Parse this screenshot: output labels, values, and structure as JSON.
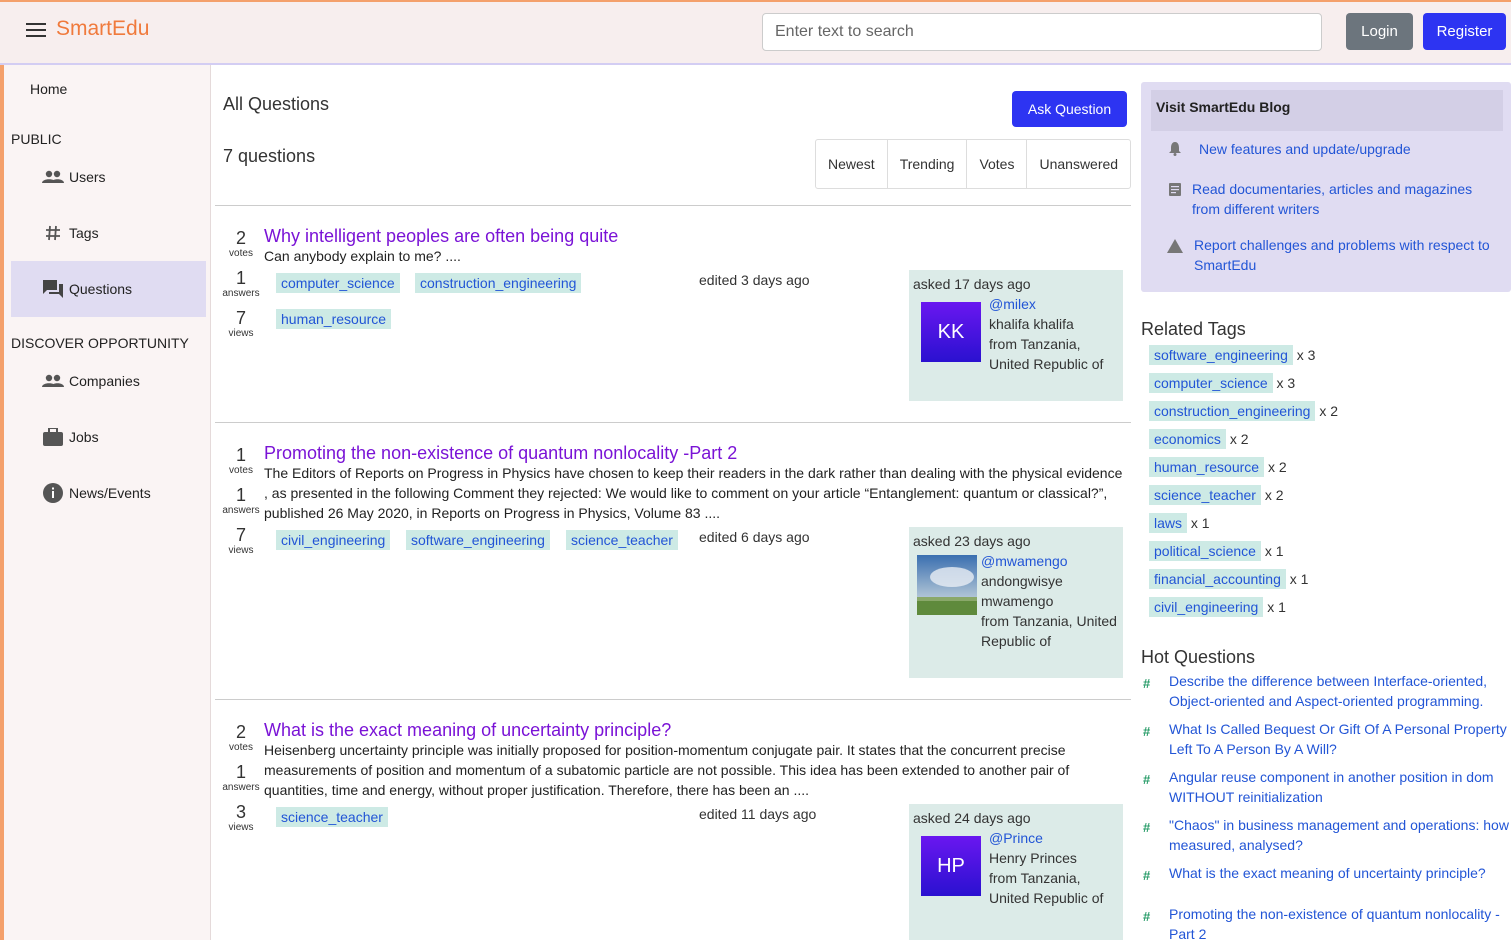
{
  "header": {
    "brand": "SmartEdu",
    "search_placeholder": "Enter text to search",
    "login": "Login",
    "register": "Register"
  },
  "sidebar": {
    "home": "Home",
    "public_label": "PUBLIC",
    "users": "Users",
    "tags": "Tags",
    "questions": "Questions",
    "discover_label": "DISCOVER OPPORTUNITY",
    "companies": "Companies",
    "jobs": "Jobs",
    "news": "News/Events"
  },
  "main": {
    "title": "All Questions",
    "ask_button": "Ask Question",
    "count": "7 questions",
    "filters": [
      "Newest",
      "Trending",
      "Votes",
      "Unanswered"
    ],
    "questions": [
      {
        "votes": "2",
        "votes_label": "votes",
        "answers": "1",
        "answers_label": "answers",
        "views": "7",
        "views_label": "views",
        "title": "Why intelligent peoples are often being quite",
        "excerpt": "Can anybody explain to me?  ....",
        "tags": [
          "computer_science",
          "construction_engineering",
          "human_resource"
        ],
        "edited": "edited 3 days ago",
        "asked": "asked 17 days ago",
        "handle": "@milex",
        "name": "khalifa khalifa",
        "location": "from Tanzania, United Republic of",
        "initials": "KK"
      },
      {
        "votes": "1",
        "votes_label": "votes",
        "answers": "1",
        "answers_label": "answers",
        "views": "7",
        "views_label": "views",
        "title": "Promoting the non-existence of quantum nonlocality -Part 2",
        "excerpt": "The Editors of Reports on Progress in Physics have chosen to keep their readers in the dark rather than dealing with the physical evidence , as presented in the following Comment they rejected: We would like to comment on your article “Entanglement: quantum or classical?”, published 26 May 2020, in Reports on Progress in Physics, Volume 83 ....",
        "tags": [
          "civil_engineering",
          "software_engineering",
          "science_teacher"
        ],
        "edited": "edited 6 days ago",
        "asked": "asked 23 days ago",
        "handle": "@mwamengo",
        "name": "andongwisye mwamengo",
        "location": "from Tanzania, United Republic of"
      },
      {
        "votes": "2",
        "votes_label": "votes",
        "answers": "1",
        "answers_label": "answers",
        "views": "3",
        "views_label": "views",
        "title": "What is the exact meaning of uncertainty principle?",
        "excerpt": "Heisenberg uncertainty principle was initially proposed for position-momentum conjugate pair. It states that the concurrent precise measurements of position and momentum of a subatomic particle are not possible. This idea has been extended to another pair of quantities, time and energy, without proper justification. Therefore, there has been an  ....",
        "tags": [
          "science_teacher"
        ],
        "edited": "edited 11 days ago",
        "asked": "asked 24 days ago",
        "handle": "@Prince",
        "name": "Henry Princes",
        "location": "from Tanzania, United Republic of",
        "initials": "HP"
      }
    ]
  },
  "blog": {
    "title": "Visit SmartEdu Blog",
    "items": [
      "New features and update/upgrade",
      "Read documentaries, articles and magazines from different writers",
      "Report challenges and problems with respect to SmartEdu"
    ]
  },
  "related_tags": {
    "title": "Related Tags",
    "items": [
      {
        "tag": "software_engineering",
        "count": "x 3"
      },
      {
        "tag": "computer_science",
        "count": "x 3"
      },
      {
        "tag": "construction_engineering",
        "count": "x 2"
      },
      {
        "tag": "economics",
        "count": "x 2"
      },
      {
        "tag": "human_resource",
        "count": "x 2"
      },
      {
        "tag": "science_teacher",
        "count": "x 2"
      },
      {
        "tag": "laws",
        "count": "x 1"
      },
      {
        "tag": "political_science",
        "count": "x 1"
      },
      {
        "tag": "financial_accounting",
        "count": "x 1"
      },
      {
        "tag": "civil_engineering",
        "count": "x 1"
      }
    ]
  },
  "hot_questions": {
    "title": "Hot Questions",
    "items": [
      "Describe the difference between Interface-oriented, Object-oriented and Aspect-oriented programming.",
      "What Is Called Bequest Or Gift Of A Personal Property Left To A Person By A Will?",
      "Angular reuse component in another position in dom WITHOUT reinitialization",
      "\"Chaos\" in business management and operations: how measured, analysed?",
      "What is the exact meaning of uncertainty principle?",
      "Promoting the non-existence of quantum nonlocality -Part 2"
    ]
  },
  "colors": {
    "brand": "#f07a3c",
    "primary": "#2d34f2",
    "tag_bg": "#cdeae5",
    "link": "#2255d6",
    "question_title": "#7a13d6"
  }
}
